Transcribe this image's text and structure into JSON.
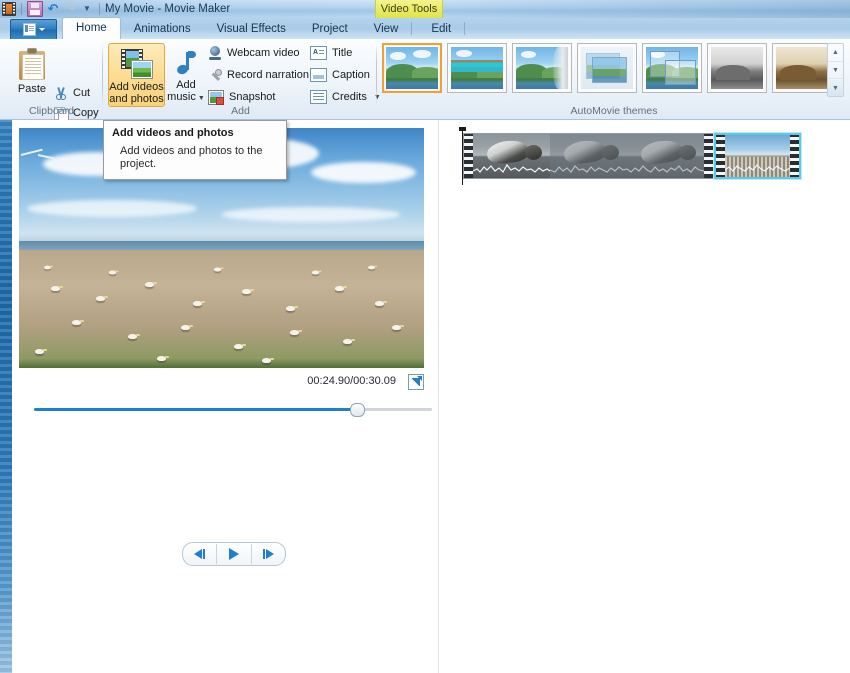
{
  "window": {
    "title": "My Movie - Movie Maker",
    "contextual_tool": "Video Tools"
  },
  "quick_access": {
    "app_icon": "film-strip-icon",
    "items": [
      {
        "name": "save-button",
        "icon": "floppy-disk-icon",
        "label": "Save Project"
      },
      {
        "name": "undo-button",
        "icon": "undo-arrow-icon",
        "label": "Undo"
      },
      {
        "name": "redo-button",
        "icon": "redo-arrow-icon",
        "label": "Redo"
      },
      {
        "name": "customize-qat-button",
        "icon": "chevron-down-icon",
        "label": "Customize Quick Access Toolbar"
      }
    ]
  },
  "file_button": {
    "label": "File",
    "icon": "file-menu-icon"
  },
  "tabs": [
    {
      "label": "Home",
      "active": true
    },
    {
      "label": "Animations",
      "active": false
    },
    {
      "label": "Visual Effects",
      "active": false
    },
    {
      "label": "Project",
      "active": false
    },
    {
      "label": "View",
      "active": false
    },
    {
      "label": "Edit",
      "active": false,
      "contextual": true
    }
  ],
  "ribbon": {
    "groups": [
      {
        "name": "clipboard",
        "label": "Clipboard",
        "big_buttons": [
          {
            "label": "Paste",
            "icon": "clipboard-icon"
          }
        ],
        "small_buttons": [
          {
            "label": "Cut",
            "icon": "scissors-icon"
          },
          {
            "label": "Copy",
            "icon": "copy-icon"
          }
        ]
      },
      {
        "name": "add",
        "label": "Add",
        "big_buttons": [
          {
            "label_line1": "Add videos",
            "label_line2": "and photos",
            "icon": "video-photo-icon",
            "highlighted": true
          },
          {
            "label_line1": "Add",
            "label_line2": "music",
            "icon": "music-note-icon",
            "has_dropdown": true
          }
        ],
        "small_buttons": [
          {
            "label": "Webcam video",
            "icon": "webcam-icon",
            "has_dropdown": false
          },
          {
            "label": "Record narration",
            "icon": "microphone-icon",
            "has_dropdown": true
          },
          {
            "label": "Snapshot",
            "icon": "snapshot-icon",
            "has_dropdown": false
          },
          {
            "label": "Title",
            "icon": "title-text-icon",
            "has_dropdown": false
          },
          {
            "label": "Caption",
            "icon": "caption-text-icon",
            "has_dropdown": false
          },
          {
            "label": "Credits",
            "icon": "credits-text-icon",
            "has_dropdown": true
          }
        ]
      },
      {
        "name": "automovie-themes",
        "label": "AutoMovie themes",
        "themes": [
          {
            "name": "no-theme",
            "selected": true
          },
          {
            "name": "contemporary",
            "selected": false
          },
          {
            "name": "cinematic",
            "selected": false
          },
          {
            "name": "fade",
            "selected": false
          },
          {
            "name": "pan-and-zoom",
            "selected": false
          },
          {
            "name": "black-and-white",
            "selected": false
          },
          {
            "name": "sepia",
            "selected": false
          }
        ],
        "scroll_buttons": [
          {
            "name": "gallery-scroll-up-button",
            "glyph": "▲"
          },
          {
            "name": "gallery-scroll-down-button",
            "glyph": "▼"
          },
          {
            "name": "gallery-more-button",
            "glyph": "▼"
          }
        ]
      }
    ]
  },
  "tooltip": {
    "title": "Add videos and photos",
    "body": "Add videos and photos to the project."
  },
  "preview": {
    "timecode": "00:24.90/00:30.09",
    "position_percent": 81,
    "fullscreen_label": "View full screen",
    "transport": [
      {
        "name": "previous-frame-button",
        "label": "Previous frame"
      },
      {
        "name": "play-button",
        "label": "Play"
      },
      {
        "name": "next-frame-button",
        "label": "Next frame"
      }
    ]
  },
  "storyboard": {
    "clips": [
      {
        "name": "clip-seals",
        "frames": 3,
        "selected": false
      },
      {
        "name": "clip-gannets",
        "frames": 1,
        "selected": true
      }
    ]
  },
  "colors": {
    "accent_blue": "#1f7ed0",
    "highlight_orange": "#e0a93a",
    "selection_cyan": "#5ec8e8",
    "contextual_yellow": "#e9eb62"
  }
}
